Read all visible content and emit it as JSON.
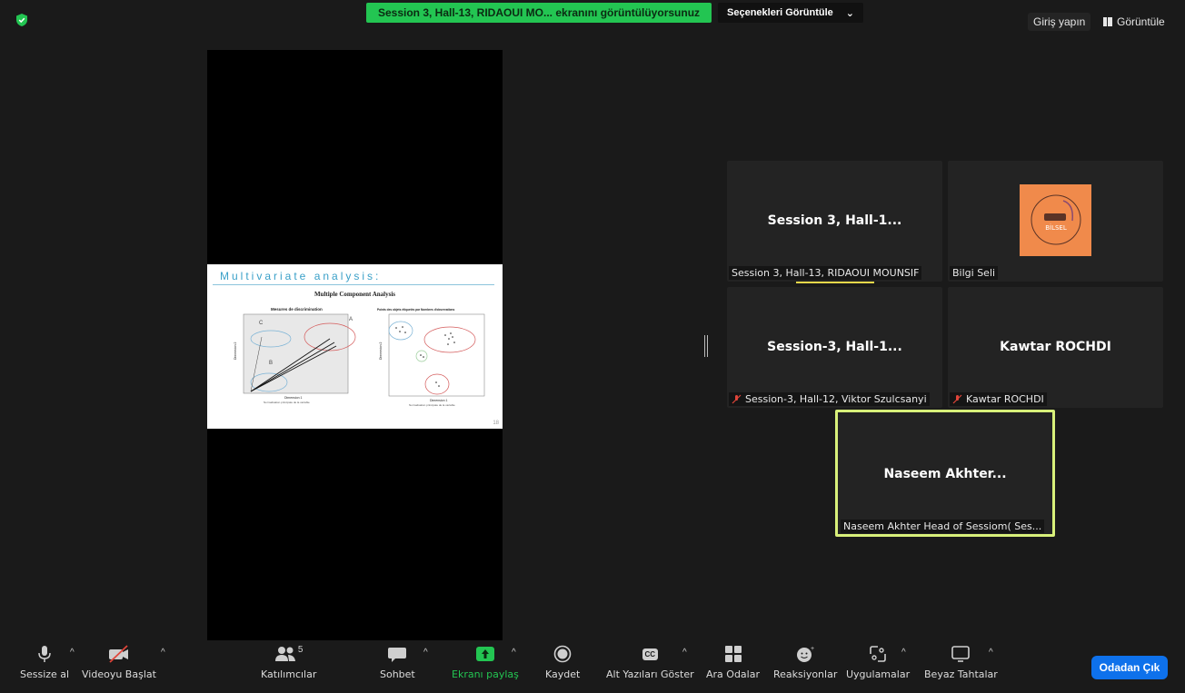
{
  "top_bar": {
    "share_banner": "Session 3, Hall-13, RIDAOUI MO... ekranını görüntülüyorsunuz",
    "options_label": "Seçenekleri Görüntüle",
    "signin_label": "Giriş yapın",
    "view_label": "Görüntüle"
  },
  "slide": {
    "title": "Multivariate analysis:",
    "subtitle": "Multiple Component Analysis",
    "left_plot_title": "Mesures de discrimination",
    "right_plot_title": "Points des objets étiquetés par Nombres d'observations",
    "left_xlabel": "Dimension 1",
    "right_xlabel": "Dimension 1",
    "left_ylabel": "Dimension 2",
    "right_ylabel": "Dimension 2",
    "left_caption": "Normalisation principale de la variable",
    "right_caption": "Normalisation principale de la variable",
    "label_a": "A",
    "label_b": "B",
    "label_c": "C",
    "page_number": "18"
  },
  "participants": [
    {
      "center": "Session 3, Hall-1...",
      "name": "Session 3, Hall-13, RIDAOUI MOUNSIF",
      "muted": false
    },
    {
      "center": "",
      "name": "Bilgi Seli",
      "muted": false,
      "avatar_text": "BİLSEL"
    },
    {
      "center": "Session-3, Hall-1...",
      "name": "Session-3, Hall-12, Viktor Szulcsanyi",
      "muted": true
    },
    {
      "center": "Kawtar ROCHDI",
      "name": "Kawtar ROCHDI",
      "muted": true
    },
    {
      "center": "Naseem Akhter...",
      "name": "Naseem Akhter Head of Sessiom( Ses...",
      "muted": false
    }
  ],
  "toolbar": {
    "mute": "Sessize al",
    "video": "Videoyu Başlat",
    "participants": "Katılımcılar",
    "participants_count": "5",
    "chat": "Sohbet",
    "share": "Ekranı paylaş",
    "record": "Kaydet",
    "captions": "Alt Yazıları Göster",
    "captions_icon_text": "CC",
    "breakout": "Ara Odalar",
    "reactions": "Reaksiyonlar",
    "apps": "Uygulamalar",
    "whiteboard": "Beyaz Tahtalar",
    "leave": "Odadan Çık"
  },
  "colors": {
    "banner_green": "#23c552",
    "leave_blue": "#0e71eb",
    "active_speaker": "#d8f07a",
    "muted_red": "#e0453a"
  }
}
